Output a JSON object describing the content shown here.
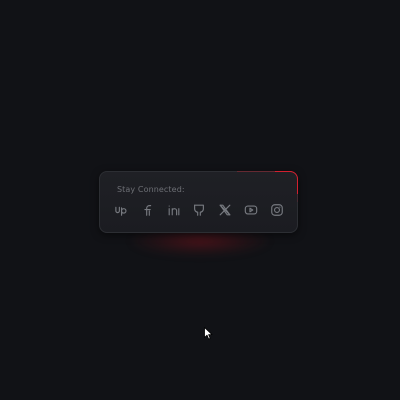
{
  "social_card": {
    "title": "Stay Connected:",
    "accent_color": "#d2202f",
    "icons": [
      {
        "name": "upwork-icon"
      },
      {
        "name": "facebook-icon"
      },
      {
        "name": "linkedin-icon"
      },
      {
        "name": "github-icon"
      },
      {
        "name": "x-icon"
      },
      {
        "name": "youtube-icon"
      },
      {
        "name": "instagram-icon"
      }
    ]
  }
}
